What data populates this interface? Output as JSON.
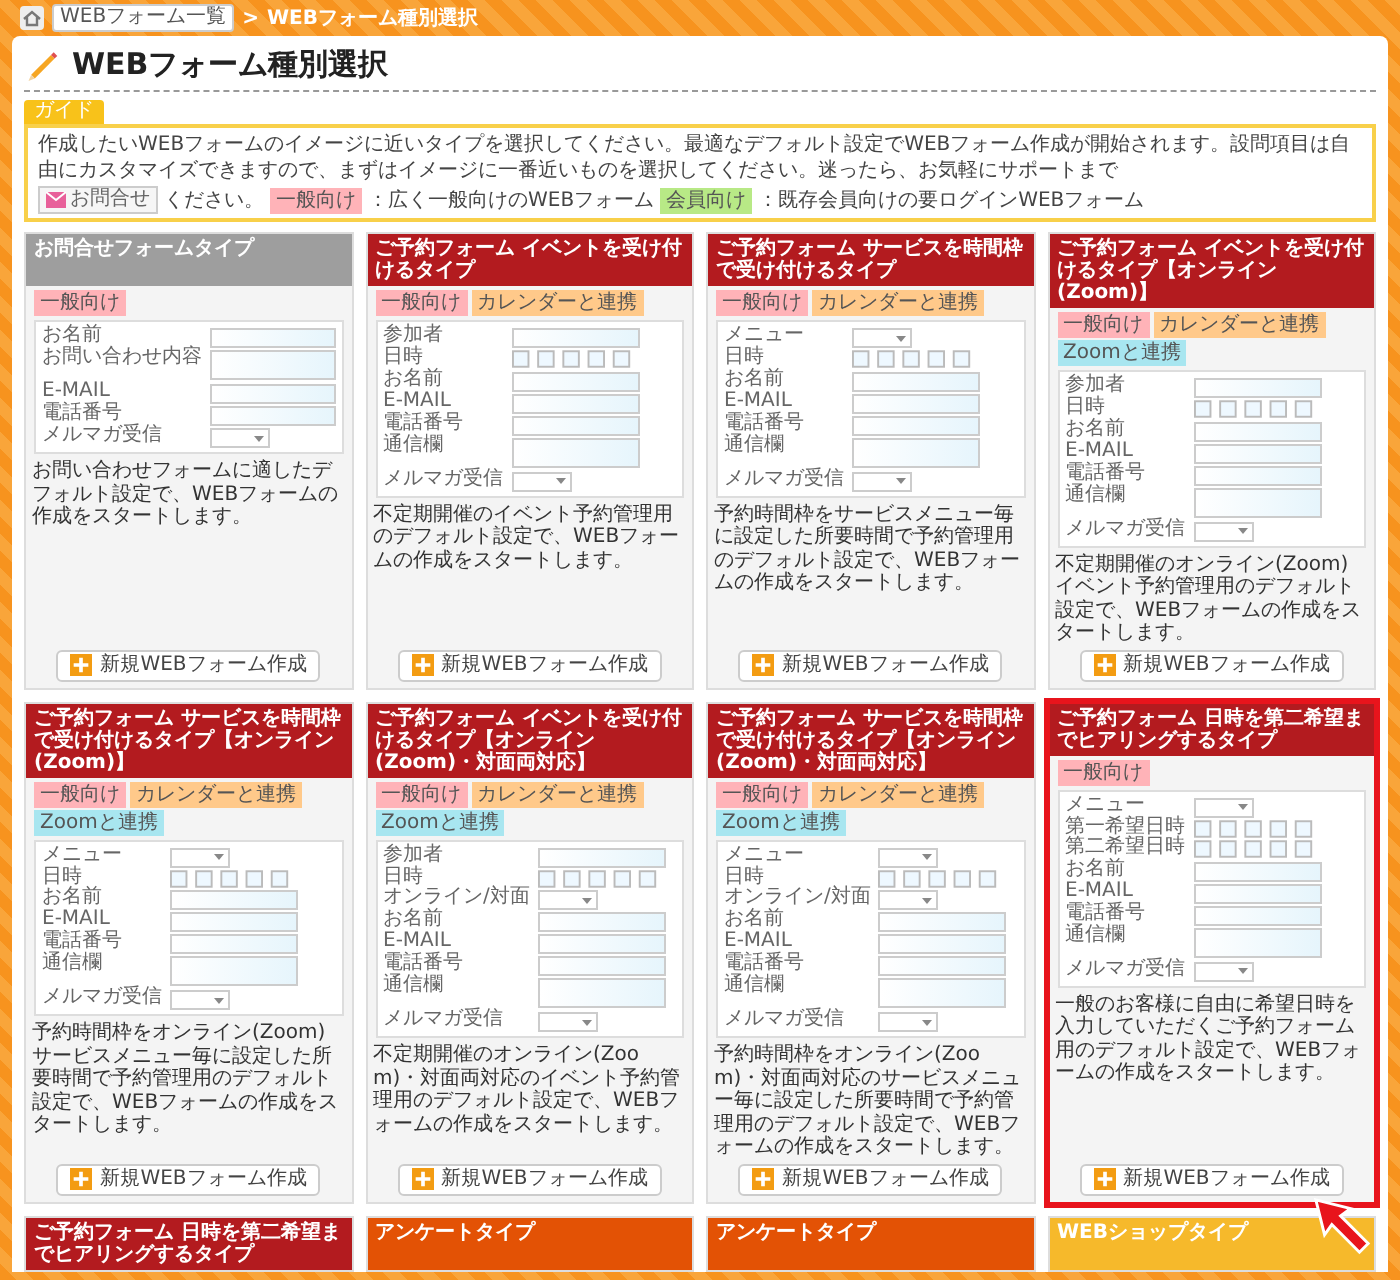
{
  "breadcrumb": {
    "link": "WEBフォーム一覧",
    "separator": ">",
    "current": "WEBフォーム種別選択"
  },
  "title": "WEBフォーム種別選択",
  "guide": {
    "label": "ガイド",
    "text": "作成したいWEBフォームのイメージに近いタイプを選択してください。最適なデフォルト設定でWEBフォーム作成が開始されます。設問項目は自由にカスタマイズできますので、まずはイメージに一番近いものを選択してください。迷ったら、お気軽にサポートまで",
    "contact_button": "お問合せ",
    "text_after": "ください。",
    "legend": [
      {
        "tag": "一般向け",
        "color": "#ffb3b8",
        "text": "：広く一般向けのWEBフォーム"
      },
      {
        "tag": "会員向け",
        "color": "#b8e986",
        "text": "：既存会員向けの要ログインWEBフォーム"
      }
    ]
  },
  "cards": [
    {
      "header": "お問合せフォームタイプ",
      "color": "#9e9e9e",
      "highlighted": false,
      "tags": [
        {
          "label": "一般向け",
          "color": "#ffb3b8"
        }
      ],
      "fields": [
        {
          "label": "お名前",
          "kind": "text"
        },
        {
          "label": "お問い合わせ内容",
          "kind": "textarea"
        },
        {
          "label": "E-MAIL",
          "kind": "text"
        },
        {
          "label": "電話番号",
          "kind": "text"
        },
        {
          "label": "メルマガ受信",
          "kind": "select"
        }
      ],
      "description": "お問い合わせフォームに適したデフォルト設定で、WEBフォームの作成をスタートします。",
      "button": "新規WEBフォーム作成"
    },
    {
      "header": "ご予約フォーム イベントを受け付けるタイプ",
      "color": "#b31b1f",
      "highlighted": false,
      "tags": [
        {
          "label": "一般向け",
          "color": "#ffb3b8"
        },
        {
          "label": "カレンダーと連携",
          "color": "#ffc98a"
        }
      ],
      "fields": [
        {
          "label": "参加者",
          "kind": "text"
        },
        {
          "label": "日時",
          "kind": "datetime"
        },
        {
          "label": "お名前",
          "kind": "text"
        },
        {
          "label": "E-MAIL",
          "kind": "text"
        },
        {
          "label": "電話番号",
          "kind": "text"
        },
        {
          "label": "通信欄",
          "kind": "textarea"
        },
        {
          "label": "メルマガ受信",
          "kind": "select"
        }
      ],
      "description": "不定期開催のイベント予約管理用のデフォルト設定で、WEBフォームの作成をスタートします。",
      "button": "新規WEBフォーム作成"
    },
    {
      "header": "ご予約フォーム サービスを時間枠で受け付けるタイプ",
      "color": "#b31b1f",
      "highlighted": false,
      "tags": [
        {
          "label": "一般向け",
          "color": "#ffb3b8"
        },
        {
          "label": "カレンダーと連携",
          "color": "#ffc98a"
        }
      ],
      "fields": [
        {
          "label": "メニュー",
          "kind": "select"
        },
        {
          "label": "日時",
          "kind": "datetime"
        },
        {
          "label": "お名前",
          "kind": "text"
        },
        {
          "label": "E-MAIL",
          "kind": "text"
        },
        {
          "label": "電話番号",
          "kind": "text"
        },
        {
          "label": "通信欄",
          "kind": "textarea"
        },
        {
          "label": "メルマガ受信",
          "kind": "select"
        }
      ],
      "description": "予約時間枠をサービスメニュー毎に設定した所要時間で予約管理用のデフォルト設定で、WEBフォームの作成をスタートします。",
      "button": "新規WEBフォーム作成"
    },
    {
      "header": "ご予約フォーム イベントを受け付けるタイプ【オンライン(Zoom)】",
      "color": "#b31b1f",
      "highlighted": false,
      "tags": [
        {
          "label": "一般向け",
          "color": "#ffb3b8"
        },
        {
          "label": "カレンダーと連携",
          "color": "#ffc98a"
        },
        {
          "label": "Zoomと連携",
          "color": "#a8e6f0"
        }
      ],
      "fields": [
        {
          "label": "参加者",
          "kind": "text"
        },
        {
          "label": "日時",
          "kind": "datetime"
        },
        {
          "label": "お名前",
          "kind": "text"
        },
        {
          "label": "E-MAIL",
          "kind": "text"
        },
        {
          "label": "電話番号",
          "kind": "text"
        },
        {
          "label": "通信欄",
          "kind": "textarea"
        },
        {
          "label": "メルマガ受信",
          "kind": "select"
        }
      ],
      "description": "不定期開催のオンライン(Zoom)イベント予約管理用のデフォルト設定で、WEBフォームの作成をスタートします。",
      "button": "新規WEBフォーム作成"
    },
    {
      "header": "ご予約フォーム サービスを時間枠で受け付けるタイプ【オンライン(Zoom)】",
      "color": "#b31b1f",
      "highlighted": false,
      "tags": [
        {
          "label": "一般向け",
          "color": "#ffb3b8"
        },
        {
          "label": "カレンダーと連携",
          "color": "#ffc98a"
        },
        {
          "label": "Zoomと連携",
          "color": "#a8e6f0"
        }
      ],
      "fields": [
        {
          "label": "メニュー",
          "kind": "select"
        },
        {
          "label": "日時",
          "kind": "datetime"
        },
        {
          "label": "お名前",
          "kind": "text"
        },
        {
          "label": "E-MAIL",
          "kind": "text"
        },
        {
          "label": "電話番号",
          "kind": "text"
        },
        {
          "label": "通信欄",
          "kind": "textarea"
        },
        {
          "label": "メルマガ受信",
          "kind": "select"
        }
      ],
      "description": "予約時間枠をオンライン(Zoom)サービスメニュー毎に設定した所要時間で予約管理用のデフォルト設定で、WEBフォームの作成をスタートします。",
      "button": "新規WEBフォーム作成"
    },
    {
      "header": "ご予約フォーム イベントを受け付けるタイプ【オンライン(Zoom)・対面両対応】",
      "color": "#b31b1f",
      "highlighted": false,
      "tags": [
        {
          "label": "一般向け",
          "color": "#ffb3b8"
        },
        {
          "label": "カレンダーと連携",
          "color": "#ffc98a"
        },
        {
          "label": "Zoomと連携",
          "color": "#a8e6f0"
        }
      ],
      "fields": [
        {
          "label": "参加者",
          "kind": "text"
        },
        {
          "label": "日時",
          "kind": "datetime"
        },
        {
          "label": "オンライン/対面",
          "kind": "select"
        },
        {
          "label": "お名前",
          "kind": "text"
        },
        {
          "label": "E-MAIL",
          "kind": "text"
        },
        {
          "label": "電話番号",
          "kind": "text"
        },
        {
          "label": "通信欄",
          "kind": "textarea"
        },
        {
          "label": "メルマガ受信",
          "kind": "select"
        }
      ],
      "description": "不定期開催のオンライン(Zoom)・対面両対応のイベント予約管理用のデフォルト設定で、WEBフォームの作成をスタートします。",
      "button": "新規WEBフォーム作成"
    },
    {
      "header": "ご予約フォーム サービスを時間枠で受け付けるタイプ【オンライン(Zoom)・対面両対応】",
      "color": "#b31b1f",
      "highlighted": false,
      "tags": [
        {
          "label": "一般向け",
          "color": "#ffb3b8"
        },
        {
          "label": "カレンダーと連携",
          "color": "#ffc98a"
        },
        {
          "label": "Zoomと連携",
          "color": "#a8e6f0"
        }
      ],
      "fields": [
        {
          "label": "メニュー",
          "kind": "select"
        },
        {
          "label": "日時",
          "kind": "datetime"
        },
        {
          "label": "オンライン/対面",
          "kind": "select"
        },
        {
          "label": "お名前",
          "kind": "text"
        },
        {
          "label": "E-MAIL",
          "kind": "text"
        },
        {
          "label": "電話番号",
          "kind": "text"
        },
        {
          "label": "通信欄",
          "kind": "textarea"
        },
        {
          "label": "メルマガ受信",
          "kind": "select"
        }
      ],
      "description": "予約時間枠をオンライン(Zoom)・対面両対応のサービスメニュー毎に設定した所要時間で予約管理用のデフォルト設定で、WEBフォームの作成をスタートします。",
      "button": "新規WEBフォーム作成"
    },
    {
      "header": "ご予約フォーム 日時を第二希望までヒアリングするタイプ",
      "color": "#b31b1f",
      "highlighted": true,
      "tags": [
        {
          "label": "一般向け",
          "color": "#ffb3b8"
        }
      ],
      "fields": [
        {
          "label": "メニュー",
          "kind": "select"
        },
        {
          "label": "第一希望日時",
          "kind": "datetime"
        },
        {
          "label": "第二希望日時",
          "kind": "datetime"
        },
        {
          "label": "お名前",
          "kind": "text"
        },
        {
          "label": "E-MAIL",
          "kind": "text"
        },
        {
          "label": "電話番号",
          "kind": "text"
        },
        {
          "label": "通信欄",
          "kind": "textarea"
        },
        {
          "label": "メルマガ受信",
          "kind": "select"
        }
      ],
      "description": "一般のお客様に自由に希望日時を入力していただくご予約フォーム用のデフォルト設定で、WEBフォームの作成をスタートします。",
      "button": "新規WEBフォーム作成"
    },
    {
      "header": "ご予約フォーム 日時を第二希望までヒアリングするタイプ",
      "color": "#b31b1f",
      "highlighted": false
    },
    {
      "header": "アンケートタイプ",
      "color": "#e35205",
      "highlighted": false
    },
    {
      "header": "アンケートタイプ",
      "color": "#e35205",
      "highlighted": false
    },
    {
      "header": "WEBショップタイプ",
      "color": "#f6b92b",
      "highlighted": false
    }
  ]
}
